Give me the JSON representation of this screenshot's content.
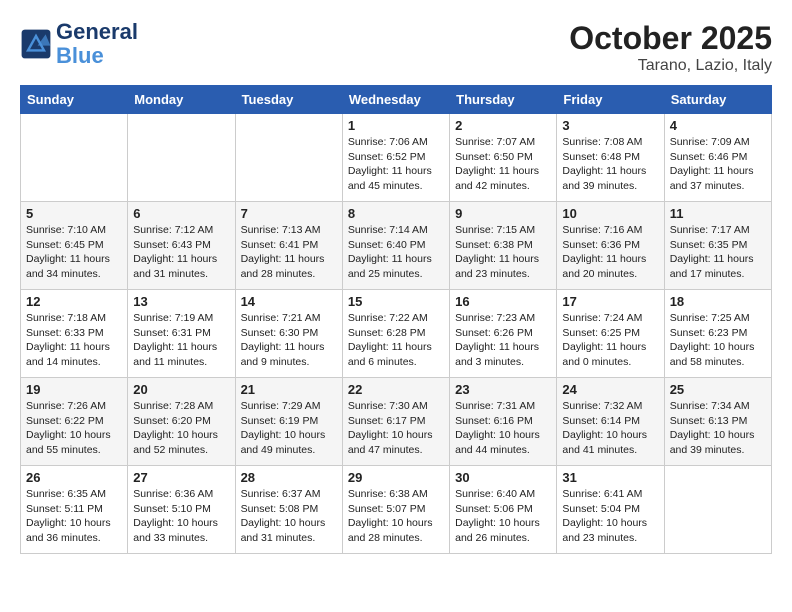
{
  "header": {
    "logo_line1": "General",
    "logo_line2": "Blue",
    "month": "October 2025",
    "location": "Tarano, Lazio, Italy"
  },
  "weekdays": [
    "Sunday",
    "Monday",
    "Tuesday",
    "Wednesday",
    "Thursday",
    "Friday",
    "Saturday"
  ],
  "weeks": [
    [
      {
        "day": "",
        "info": ""
      },
      {
        "day": "",
        "info": ""
      },
      {
        "day": "",
        "info": ""
      },
      {
        "day": "1",
        "info": "Sunrise: 7:06 AM\nSunset: 6:52 PM\nDaylight: 11 hours and 45 minutes."
      },
      {
        "day": "2",
        "info": "Sunrise: 7:07 AM\nSunset: 6:50 PM\nDaylight: 11 hours and 42 minutes."
      },
      {
        "day": "3",
        "info": "Sunrise: 7:08 AM\nSunset: 6:48 PM\nDaylight: 11 hours and 39 minutes."
      },
      {
        "day": "4",
        "info": "Sunrise: 7:09 AM\nSunset: 6:46 PM\nDaylight: 11 hours and 37 minutes."
      }
    ],
    [
      {
        "day": "5",
        "info": "Sunrise: 7:10 AM\nSunset: 6:45 PM\nDaylight: 11 hours and 34 minutes."
      },
      {
        "day": "6",
        "info": "Sunrise: 7:12 AM\nSunset: 6:43 PM\nDaylight: 11 hours and 31 minutes."
      },
      {
        "day": "7",
        "info": "Sunrise: 7:13 AM\nSunset: 6:41 PM\nDaylight: 11 hours and 28 minutes."
      },
      {
        "day": "8",
        "info": "Sunrise: 7:14 AM\nSunset: 6:40 PM\nDaylight: 11 hours and 25 minutes."
      },
      {
        "day": "9",
        "info": "Sunrise: 7:15 AM\nSunset: 6:38 PM\nDaylight: 11 hours and 23 minutes."
      },
      {
        "day": "10",
        "info": "Sunrise: 7:16 AM\nSunset: 6:36 PM\nDaylight: 11 hours and 20 minutes."
      },
      {
        "day": "11",
        "info": "Sunrise: 7:17 AM\nSunset: 6:35 PM\nDaylight: 11 hours and 17 minutes."
      }
    ],
    [
      {
        "day": "12",
        "info": "Sunrise: 7:18 AM\nSunset: 6:33 PM\nDaylight: 11 hours and 14 minutes."
      },
      {
        "day": "13",
        "info": "Sunrise: 7:19 AM\nSunset: 6:31 PM\nDaylight: 11 hours and 11 minutes."
      },
      {
        "day": "14",
        "info": "Sunrise: 7:21 AM\nSunset: 6:30 PM\nDaylight: 11 hours and 9 minutes."
      },
      {
        "day": "15",
        "info": "Sunrise: 7:22 AM\nSunset: 6:28 PM\nDaylight: 11 hours and 6 minutes."
      },
      {
        "day": "16",
        "info": "Sunrise: 7:23 AM\nSunset: 6:26 PM\nDaylight: 11 hours and 3 minutes."
      },
      {
        "day": "17",
        "info": "Sunrise: 7:24 AM\nSunset: 6:25 PM\nDaylight: 11 hours and 0 minutes."
      },
      {
        "day": "18",
        "info": "Sunrise: 7:25 AM\nSunset: 6:23 PM\nDaylight: 10 hours and 58 minutes."
      }
    ],
    [
      {
        "day": "19",
        "info": "Sunrise: 7:26 AM\nSunset: 6:22 PM\nDaylight: 10 hours and 55 minutes."
      },
      {
        "day": "20",
        "info": "Sunrise: 7:28 AM\nSunset: 6:20 PM\nDaylight: 10 hours and 52 minutes."
      },
      {
        "day": "21",
        "info": "Sunrise: 7:29 AM\nSunset: 6:19 PM\nDaylight: 10 hours and 49 minutes."
      },
      {
        "day": "22",
        "info": "Sunrise: 7:30 AM\nSunset: 6:17 PM\nDaylight: 10 hours and 47 minutes."
      },
      {
        "day": "23",
        "info": "Sunrise: 7:31 AM\nSunset: 6:16 PM\nDaylight: 10 hours and 44 minutes."
      },
      {
        "day": "24",
        "info": "Sunrise: 7:32 AM\nSunset: 6:14 PM\nDaylight: 10 hours and 41 minutes."
      },
      {
        "day": "25",
        "info": "Sunrise: 7:34 AM\nSunset: 6:13 PM\nDaylight: 10 hours and 39 minutes."
      }
    ],
    [
      {
        "day": "26",
        "info": "Sunrise: 6:35 AM\nSunset: 5:11 PM\nDaylight: 10 hours and 36 minutes."
      },
      {
        "day": "27",
        "info": "Sunrise: 6:36 AM\nSunset: 5:10 PM\nDaylight: 10 hours and 33 minutes."
      },
      {
        "day": "28",
        "info": "Sunrise: 6:37 AM\nSunset: 5:08 PM\nDaylight: 10 hours and 31 minutes."
      },
      {
        "day": "29",
        "info": "Sunrise: 6:38 AM\nSunset: 5:07 PM\nDaylight: 10 hours and 28 minutes."
      },
      {
        "day": "30",
        "info": "Sunrise: 6:40 AM\nSunset: 5:06 PM\nDaylight: 10 hours and 26 minutes."
      },
      {
        "day": "31",
        "info": "Sunrise: 6:41 AM\nSunset: 5:04 PM\nDaylight: 10 hours and 23 minutes."
      },
      {
        "day": "",
        "info": ""
      }
    ]
  ]
}
